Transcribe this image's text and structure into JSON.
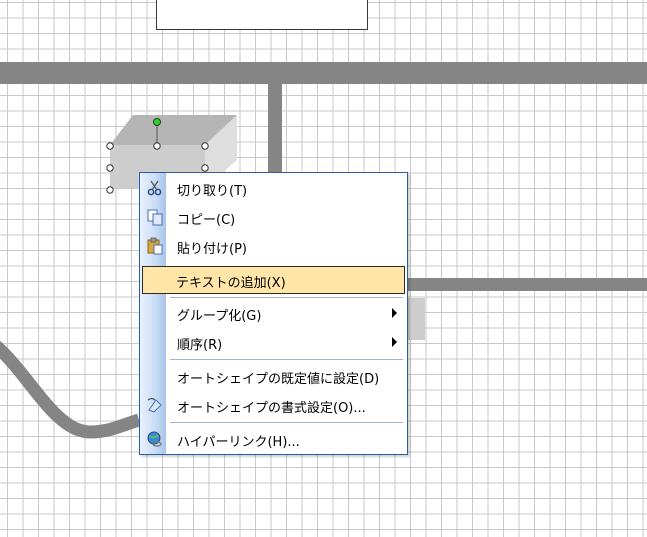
{
  "colors": {
    "connector": "#858585",
    "shape_top": "#b8b8b8",
    "shape_front": "#cdcdcd",
    "shape_side": "#dcdcdc",
    "selection_handle": "#ffffff",
    "rotation_handle": "#22dd22",
    "menu_border": "#2a5ea8",
    "menu_highlight": "#ffe6a8"
  },
  "context_menu": {
    "items": [
      {
        "label": "切り取り(T)",
        "icon": "scissors-icon",
        "submenu": false
      },
      {
        "label": "コピー(C)",
        "icon": "copy-icon",
        "submenu": false
      },
      {
        "label": "貼り付け(P)",
        "icon": "paste-icon",
        "submenu": false
      },
      {
        "label": "テキストの追加(X)",
        "icon": "",
        "submenu": false,
        "highlighted": true
      },
      {
        "label": "グループ化(G)",
        "icon": "",
        "submenu": true
      },
      {
        "label": "順序(R)",
        "icon": "",
        "submenu": true
      },
      {
        "label": "オートシェイプの既定値に設定(D)",
        "icon": "",
        "submenu": false
      },
      {
        "label": "オートシェイプの書式設定(O)...",
        "icon": "format-shape-icon",
        "submenu": false
      },
      {
        "label": "ハイパーリンク(H)...",
        "icon": "hyperlink-globe-icon",
        "submenu": false
      }
    ]
  }
}
